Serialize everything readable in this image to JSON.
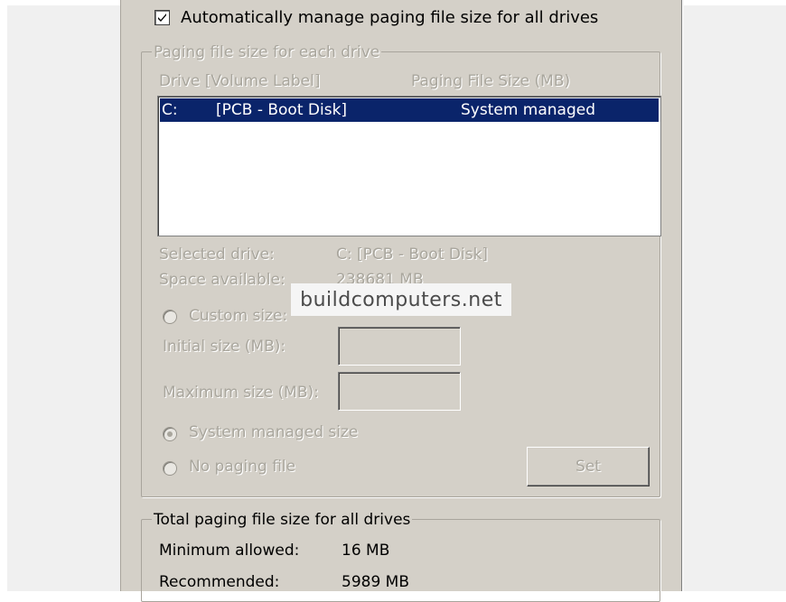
{
  "auto_manage": {
    "label": "Automatically manage paging file size for all drives",
    "checked": true
  },
  "per_drive_group": {
    "legend": "Paging file size for each drive",
    "columns": [
      "Drive  [Volume Label]",
      "Paging File Size (MB)"
    ],
    "rows": [
      {
        "drive": "C:",
        "label": "[PCB - Boot Disk]",
        "size": "System managed",
        "selected": true
      }
    ],
    "selected_drive_label": "Selected drive:",
    "selected_drive_value": "C:  [PCB - Boot Disk]",
    "space_available_label": "Space available:",
    "space_available_value": "238681 MB",
    "custom_size_label": "Custom size:",
    "initial_size_label": "Initial size (MB):",
    "initial_size_value": "",
    "maximum_size_label": "Maximum size (MB):",
    "maximum_size_value": "",
    "system_managed_label": "System managed size",
    "no_paging_label": "No paging file",
    "selected_option": "system_managed",
    "set_button": "Set"
  },
  "watermark": "buildcomputers.net",
  "total_group": {
    "legend": "Total paging file size for all drives",
    "minimum_label": "Minimum allowed:",
    "minimum_value": "16 MB",
    "recommended_label": "Recommended:",
    "recommended_value": "5989 MB"
  },
  "colors": {
    "dialog_bg": "#d4d0c8",
    "selection": "#0a246a",
    "disabled_text": "#a9a69d"
  }
}
